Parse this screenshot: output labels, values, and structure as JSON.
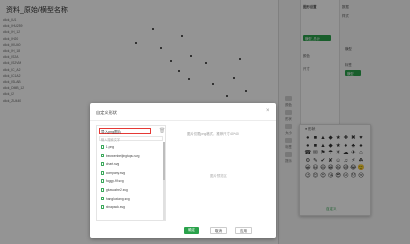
{
  "chart": {
    "title": "资料_原始/横型名称",
    "y_labels": [
      "click_IU1",
      "click_IHU259",
      "click_IH_12",
      "click_IH20",
      "click_IKU40",
      "click_IH_18",
      "click_IS2A",
      "click_IS2VM",
      "click_IC_A2",
      "click_IC1A2",
      "click_ISLAB",
      "click_DMB_12",
      "click_I2",
      "click_ZU440"
    ]
  },
  "right_panel": {
    "title": "图形设置",
    "tab_a": "数据",
    "tab_b": "样式",
    "selected_field": "横型_总计",
    "section1": "颜色",
    "section2": "尺寸",
    "field_b": "横型",
    "field_c": "标签",
    "green_label": "横型",
    "side_items": [
      "颜色",
      "形状",
      "大小",
      "标签",
      "提示"
    ]
  },
  "dialog": {
    "title": "自定义形状",
    "close": "×",
    "image_search_value": "导入png图片",
    "search_placeholder": "输入搜索文字",
    "hint": "图片仅限png格式，推荐尺寸40*40",
    "preview_label": "图片预览区",
    "files": [
      "1.png",
      "beowenbeijingtupu.svg",
      "chart.svg",
      "company.svg",
      "foggy-flf.svg",
      "gtuwuzhe2.svg",
      "hangluxiang.svg",
      "xinapack.svg"
    ],
    "ok_label": "确定",
    "cancel_label": "取消",
    "apply_label": "应用"
  },
  "palette": {
    "header": "● 形状",
    "icons": [
      "●",
      "■",
      "▲",
      "◆",
      "★",
      "✚",
      "✖",
      "♥",
      "●",
      "■",
      "▲",
      "◆",
      "★",
      "♦",
      "♣",
      "♠",
      "☎",
      "✉",
      "⚑",
      "☂",
      "☀",
      "☁",
      "✈",
      "⌂",
      "⚙",
      "✎",
      "✔",
      "✘",
      "☺",
      "♫",
      "⚡",
      "☘",
      "😀",
      "😃",
      "😄",
      "😁",
      "😆",
      "😅",
      "😂",
      "🙂",
      "😉",
      "😊",
      "😍",
      "😘",
      "😎",
      "😐",
      "😞",
      "😢"
    ],
    "footer": "自定义"
  },
  "colors": {
    "accent": "#2aa24b",
    "highlight": "#e53935"
  }
}
